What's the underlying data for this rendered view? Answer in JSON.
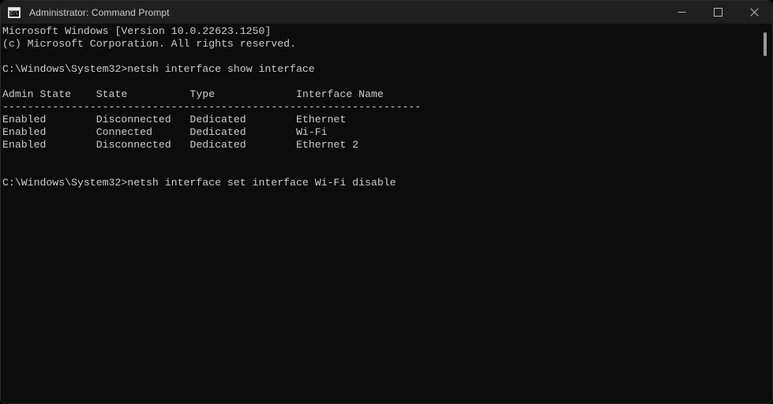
{
  "window": {
    "title": "Administrator: Command Prompt",
    "icon": "command-prompt-icon",
    "icon_glyph": "C:\\",
    "background_color": "#0c0c0c",
    "titlebar_color": "#1f1f1f",
    "text_color": "#cccccc"
  },
  "titlebar_controls": {
    "minimize_label": "Minimize",
    "maximize_label": "Maximize",
    "close_label": "Close"
  },
  "terminal": {
    "banner": {
      "line1": "Microsoft Windows [Version 10.0.22623.1250]",
      "line2": "(c) Microsoft Corporation. All rights reserved."
    },
    "prompt": "C:\\Windows\\System32>",
    "command_1": "netsh interface show interface",
    "command_2": "netsh interface set interface Wi-Fi disable",
    "table": {
      "headers": [
        "Admin State",
        "State",
        "Type",
        "Interface Name"
      ],
      "separator": "---------------------------------------------------------------------",
      "rows": [
        [
          "Enabled",
          "Disconnected",
          "Dedicated",
          "Ethernet"
        ],
        [
          "Enabled",
          "Connected",
          "Dedicated",
          "Wi-Fi"
        ],
        [
          "Enabled",
          "Disconnected",
          "Dedicated",
          "Ethernet 2"
        ]
      ]
    },
    "full_text": "Microsoft Windows [Version 10.0.22623.1250]\n(c) Microsoft Corporation. All rights reserved.\n\nC:\\Windows\\System32>netsh interface show interface\n\nAdmin State    State          Type             Interface Name\n-------------------------------------------------------------------\nEnabled        Disconnected   Dedicated        Ethernet\nEnabled        Connected      Dedicated        Wi-Fi\nEnabled        Disconnected   Dedicated        Ethernet 2\n\n\nC:\\Windows\\System32>netsh interface set interface Wi-Fi disable"
  },
  "scrollbar": {
    "position": "top"
  }
}
